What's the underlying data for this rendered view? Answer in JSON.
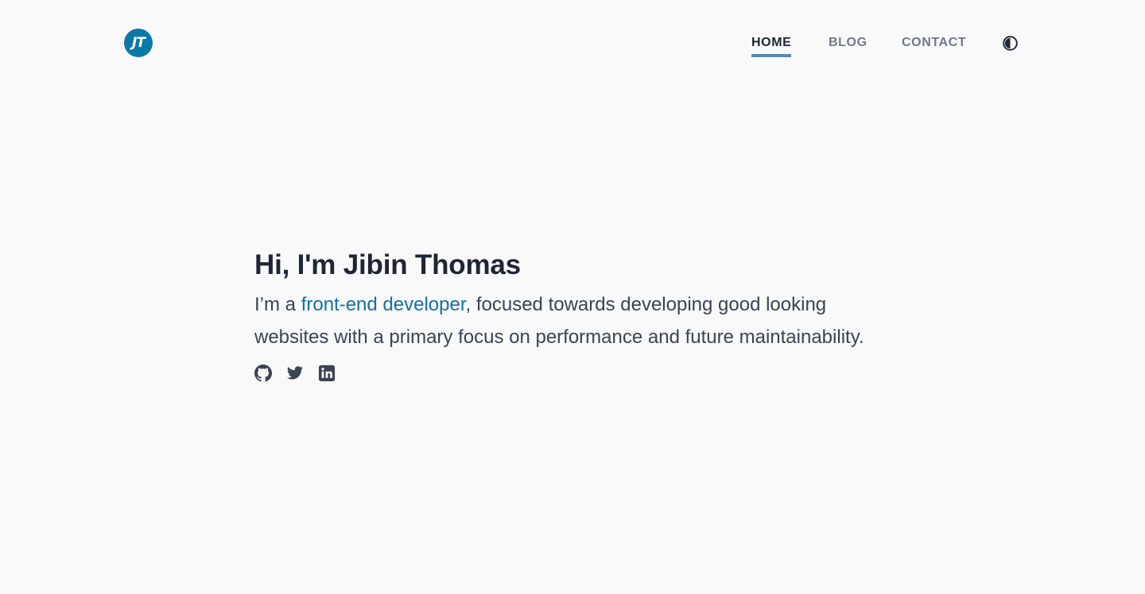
{
  "header": {
    "logo_text": "JT",
    "nav": [
      {
        "label": "HOME",
        "active": true
      },
      {
        "label": "BLOG",
        "active": false
      },
      {
        "label": "CONTACT",
        "active": false
      }
    ],
    "theme_toggle_icon": "contrast-icon"
  },
  "hero": {
    "title": "Hi, I'm Jibin Thomas",
    "text_before": "I’m a ",
    "link_text": "front-end developer",
    "text_after": ", focused towards developing good looking websites with a primary focus on performance and future maintainability."
  },
  "socials": [
    {
      "icon": "github-icon"
    },
    {
      "icon": "twitter-icon"
    },
    {
      "icon": "linkedin-icon"
    }
  ],
  "colors": {
    "background": "#f9f9f9",
    "accent": "#1470a6",
    "logo": "#0a79a8",
    "nav_active_underline": "#5689ad",
    "text_dark": "#1e2533",
    "nav_muted": "#6b7a8f"
  }
}
